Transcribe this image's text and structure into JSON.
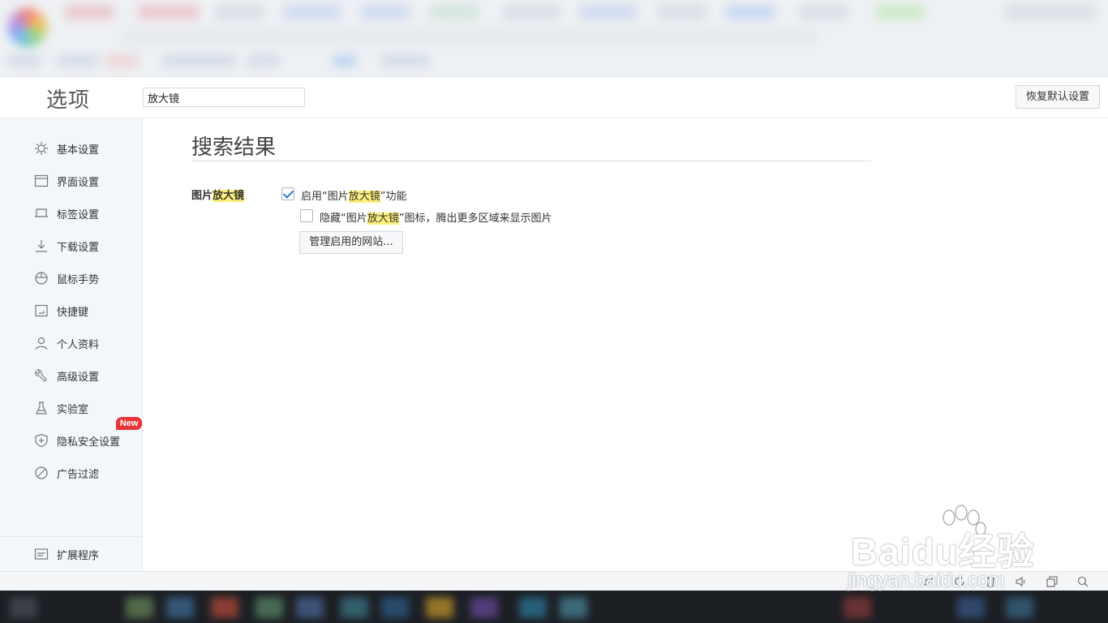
{
  "header": {
    "title": "选项",
    "search_value": "放大镜",
    "restore_label": "恢复默认设置"
  },
  "sidebar": {
    "items": [
      {
        "label": "基本设置",
        "icon": "gear-icon"
      },
      {
        "label": "界面设置",
        "icon": "window-icon"
      },
      {
        "label": "标签设置",
        "icon": "tab-icon"
      },
      {
        "label": "下载设置",
        "icon": "download-icon"
      },
      {
        "label": "鼠标手势",
        "icon": "mouse-icon"
      },
      {
        "label": "快捷键",
        "icon": "keyboard-icon"
      },
      {
        "label": "个人资料",
        "icon": "user-icon"
      },
      {
        "label": "高级设置",
        "icon": "wrench-icon"
      },
      {
        "label": "实验室",
        "icon": "flask-icon"
      },
      {
        "label": "隐私安全设置",
        "icon": "shield-icon"
      },
      {
        "label": "广告过滤",
        "icon": "block-icon"
      }
    ],
    "new_badge": "New",
    "extensions_label": "扩展程序"
  },
  "main": {
    "heading": "搜索结果",
    "section": {
      "prefix": "图片",
      "highlight": "放大镜"
    },
    "option1": {
      "prefix": "启用“图片",
      "highlight": "放大镜",
      "suffix": "”功能",
      "checked": true
    },
    "option2": {
      "prefix": "隐藏“图片",
      "highlight": "放大镜",
      "suffix": "”图标，腾出更多区域来显示图片",
      "checked": false
    },
    "manage_button": "管理启用的网站..."
  },
  "statusbar_icons": [
    "rocket-icon",
    "refresh-icon",
    "trash-icon",
    "speaker-icon",
    "window-icon",
    "search-icon"
  ],
  "watermark": {
    "brand": "Bai",
    "brand2": "du",
    "brand3": "经验",
    "url": "jingyan.baidu.com"
  },
  "colors": {
    "highlight": "#fbee7a",
    "badge": "#e8353a",
    "check": "#2a7ad5"
  }
}
